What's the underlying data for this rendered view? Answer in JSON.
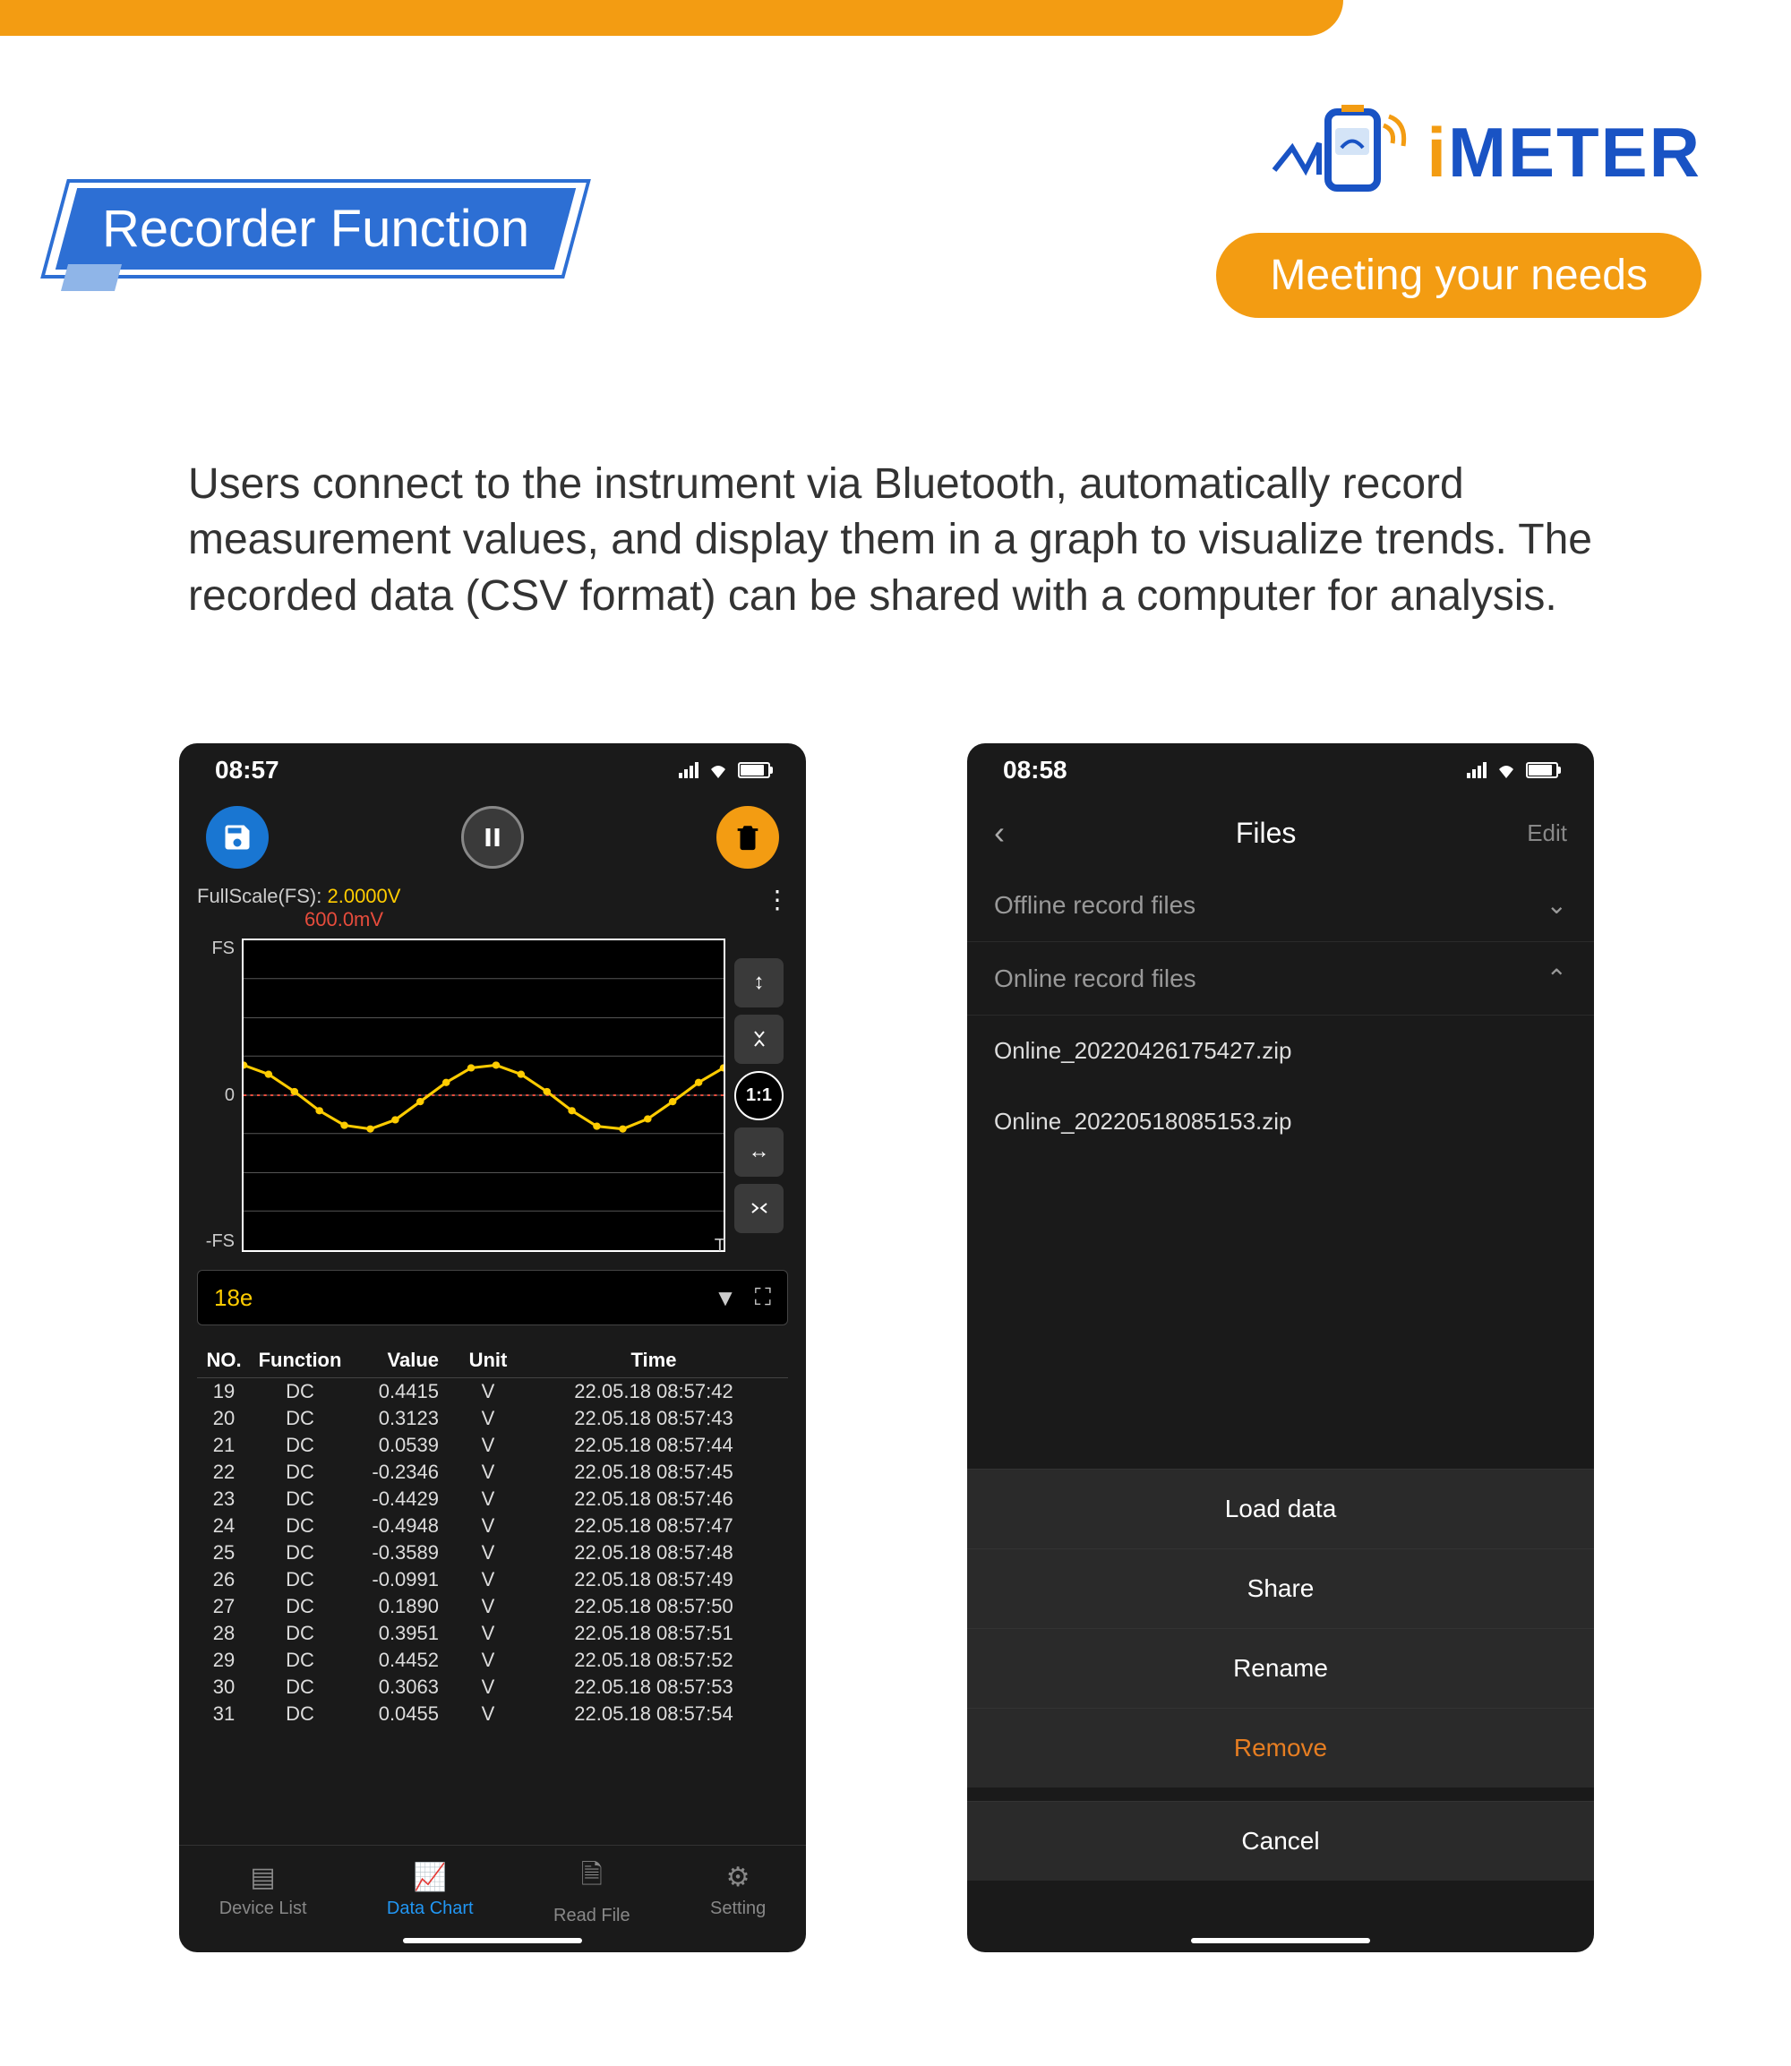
{
  "header": {
    "title": "Recorder Function",
    "brand": "METER",
    "tagline": "Meeting your  needs"
  },
  "description": "Users connect to the instrument via Bluetooth, automatically record measurement values, and display them in a graph to visualize trends. The recorded data (CSV format) can be shared with a computer for analysis.",
  "phone1": {
    "time": "08:57",
    "fullscale_label": "FullScale(FS):",
    "fullscale_value": "2.0000V",
    "fullscale_sub": "600.0mV",
    "axis_fs": "FS",
    "axis_zero": "0",
    "axis_nfs": "-FS",
    "axis_t": "T",
    "ratio": "1:1",
    "selector": "18e",
    "columns": {
      "no": "NO.",
      "fn": "Function",
      "val": "Value",
      "unit": "Unit",
      "time": "Time"
    },
    "rows": [
      {
        "no": "19",
        "fn": "DC",
        "val": "0.4415",
        "unit": "V",
        "time": "22.05.18 08:57:42"
      },
      {
        "no": "20",
        "fn": "DC",
        "val": "0.3123",
        "unit": "V",
        "time": "22.05.18 08:57:43"
      },
      {
        "no": "21",
        "fn": "DC",
        "val": "0.0539",
        "unit": "V",
        "time": "22.05.18 08:57:44"
      },
      {
        "no": "22",
        "fn": "DC",
        "val": "-0.2346",
        "unit": "V",
        "time": "22.05.18 08:57:45"
      },
      {
        "no": "23",
        "fn": "DC",
        "val": "-0.4429",
        "unit": "V",
        "time": "22.05.18 08:57:46"
      },
      {
        "no": "24",
        "fn": "DC",
        "val": "-0.4948",
        "unit": "V",
        "time": "22.05.18 08:57:47"
      },
      {
        "no": "25",
        "fn": "DC",
        "val": "-0.3589",
        "unit": "V",
        "time": "22.05.18 08:57:48"
      },
      {
        "no": "26",
        "fn": "DC",
        "val": "-0.0991",
        "unit": "V",
        "time": "22.05.18 08:57:49"
      },
      {
        "no": "27",
        "fn": "DC",
        "val": "0.1890",
        "unit": "V",
        "time": "22.05.18 08:57:50"
      },
      {
        "no": "28",
        "fn": "DC",
        "val": "0.3951",
        "unit": "V",
        "time": "22.05.18 08:57:51"
      },
      {
        "no": "29",
        "fn": "DC",
        "val": "0.4452",
        "unit": "V",
        "time": "22.05.18 08:57:52"
      },
      {
        "no": "30",
        "fn": "DC",
        "val": "0.3063",
        "unit": "V",
        "time": "22.05.18 08:57:53"
      },
      {
        "no": "31",
        "fn": "DC",
        "val": "0.0455",
        "unit": "V",
        "time": "22.05.18 08:57:54"
      }
    ],
    "nav": {
      "device": "Device List",
      "chart": "Data Chart",
      "read": "Read File",
      "setting": "Setting"
    }
  },
  "phone2": {
    "time": "08:58",
    "title": "Files",
    "edit": "Edit",
    "sections": {
      "offline": "Offline record files",
      "online": "Online record files"
    },
    "files": [
      "Online_20220426175427.zip",
      "Online_20220518085153.zip"
    ],
    "actions": {
      "load": "Load data",
      "share": "Share",
      "rename": "Rename",
      "remove": "Remove",
      "cancel": "Cancel"
    }
  },
  "chart_data": {
    "type": "line",
    "title": "Recorded DC signal",
    "ylabel": "V",
    "ylim": [
      -2.0,
      2.0
    ],
    "series": [
      {
        "name": "yellow",
        "values": [
          0.44,
          0.31,
          0.05,
          -0.23,
          -0.44,
          -0.49,
          -0.36,
          -0.1,
          0.19,
          0.4,
          0.45,
          0.31,
          0.05,
          -0.23,
          -0.45,
          -0.49,
          -0.35,
          -0.1,
          0.19,
          0.4
        ]
      },
      {
        "name": "red",
        "values": [
          0,
          0,
          0,
          0,
          0,
          0,
          0,
          0,
          0,
          0,
          0,
          0,
          0,
          0,
          0,
          0,
          0,
          0,
          0,
          0
        ]
      }
    ]
  }
}
